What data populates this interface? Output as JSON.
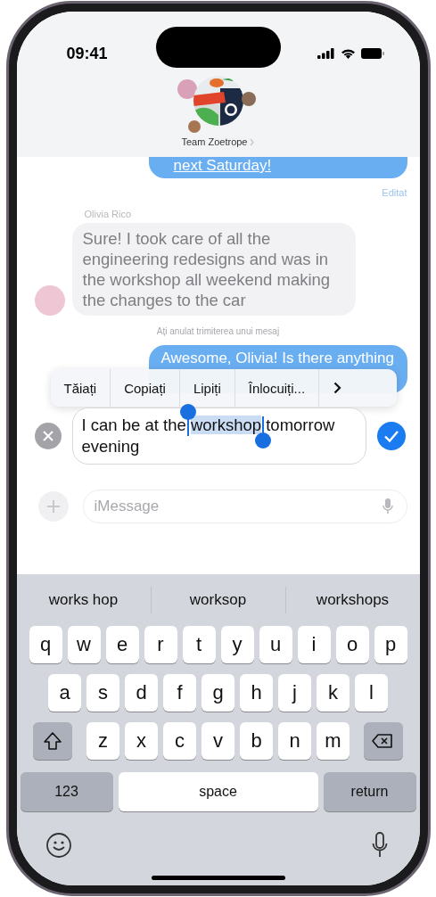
{
  "status_bar": {
    "time": "09:41"
  },
  "header": {
    "title": "Team Zoetrope"
  },
  "messages": [
    {
      "kind": "sent",
      "text": "next Saturday!",
      "edited_label": "Editat"
    },
    {
      "kind": "received",
      "sender": "Olivia Rico",
      "text": "Sure! I took care of all the engineering redesigns and was in the workshop all weekend making the changes to the car"
    },
    {
      "kind": "notice",
      "text": "Ați anulat trimiterea unui mesaj"
    },
    {
      "kind": "sent",
      "text": "Awesome, Olivia! Is there anything"
    }
  ],
  "edit_menu": {
    "items": [
      "Tăiați",
      "Copiați",
      "Lipiți",
      "Înlocuiți..."
    ]
  },
  "editor": {
    "before": "I can be at the ",
    "selected": "workshop",
    "after": " tomorrow evening"
  },
  "compose": {
    "placeholder": "iMessage"
  },
  "keyboard": {
    "suggestions": [
      "works hop",
      "worksop",
      "workshops"
    ],
    "rows": [
      [
        "q",
        "w",
        "e",
        "r",
        "t",
        "y",
        "u",
        "i",
        "o",
        "p"
      ],
      [
        "a",
        "s",
        "d",
        "f",
        "g",
        "h",
        "j",
        "k",
        "l"
      ],
      [
        "z",
        "x",
        "c",
        "v",
        "b",
        "n",
        "m"
      ]
    ],
    "numbers_key": "123",
    "space_key": "space",
    "return_key": "return"
  }
}
